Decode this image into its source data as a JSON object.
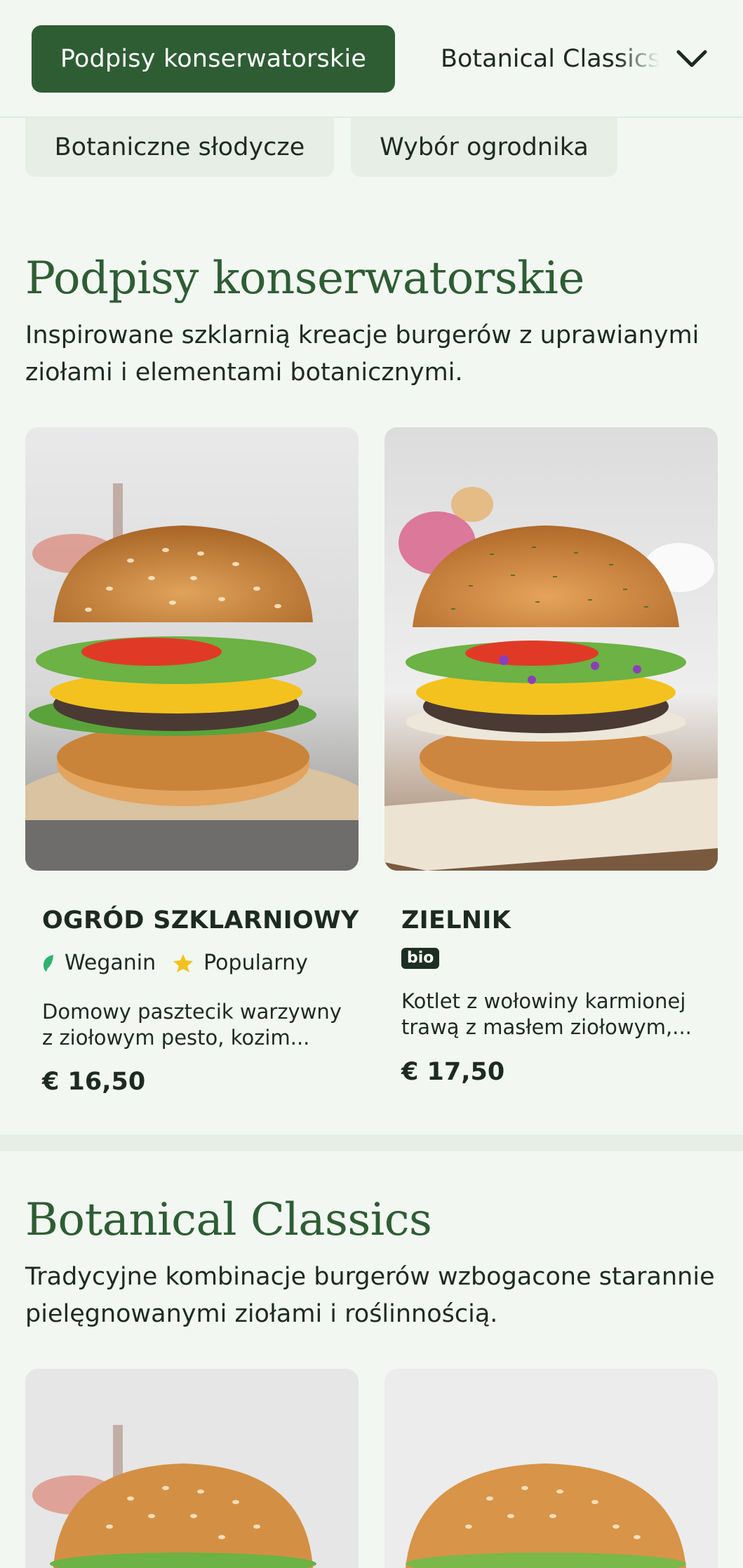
{
  "nav": {
    "active_chip": "Podpisy konserwatorskie",
    "next_chip": "Botanical Classics",
    "row2": [
      "Botaniczne słodycze",
      "Wybór ogrodnika"
    ]
  },
  "sections": [
    {
      "title": "Podpisy konserwatorskie",
      "description": "Inspirowane szklarnią kreacje burgerów z uprawianymi ziołami i elementami botanicznymi.",
      "items": [
        {
          "name": "OGRÓD SZKLARNIOWY",
          "tags": [
            "Weganin",
            "Popularny"
          ],
          "description_line1": "Domowy pasztecik warzywny",
          "description_line2": "z ziołowym pesto, kozim...",
          "price": "€ 16,50"
        },
        {
          "name": "ZIELNIK",
          "badge": "bio",
          "description_line1": "Kotlet z wołowiny karmionej",
          "description_line2": "trawą z masłem ziołowym,...",
          "price": "€ 17,50"
        }
      ]
    },
    {
      "title": "Botanical Classics",
      "description": "Tradycyjne kombinacje burgerów wzbogacone starannie pielęgnowanymi ziołami i roślinnością."
    }
  ],
  "colors": {
    "accent": "#2e5d34",
    "background": "#f2f7f2",
    "leaf_tag": "#2fb36b",
    "star_tag": "#f2c21b"
  },
  "icons": [
    "chevron-down-icon",
    "leaf-icon",
    "star-icon"
  ]
}
